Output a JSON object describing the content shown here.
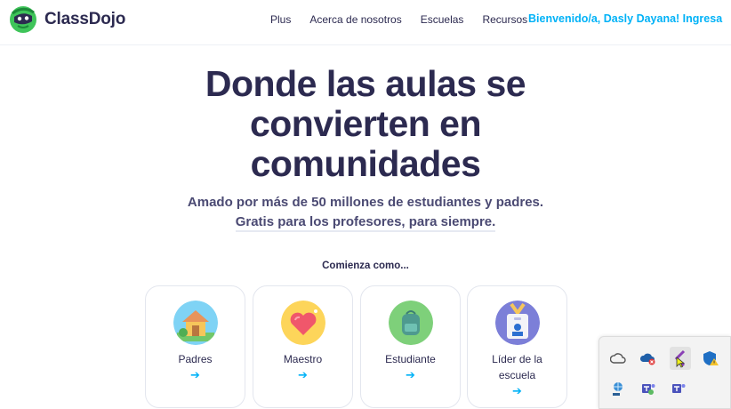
{
  "nav": {
    "brand": "ClassDojo",
    "links": [
      "Plus",
      "Acerca de nosotros",
      "Escuelas",
      "Recursos"
    ],
    "cta": "Bienvenido/a, Dasly Dayana! Ingresa"
  },
  "hero": {
    "title_lines": [
      "Donde las aulas se",
      "convierten en",
      "comunidades"
    ],
    "subtitle_line1": "Amado por más de 50 millones de estudiantes y padres.",
    "subtitle_line2": "Gratis para los profesores, para siempre."
  },
  "start_label": "Comienza como...",
  "roles": [
    {
      "label": "Padres",
      "arrow": "➔",
      "icon": "house-icon"
    },
    {
      "label": "Maestro",
      "arrow": "➔",
      "icon": "heart-icon"
    },
    {
      "label": "Estudiante",
      "arrow": "➔",
      "icon": "backpack-icon"
    },
    {
      "label": "Líder de la escuela",
      "label_line1": "Líder de la",
      "label_line2": "escuela",
      "arrow": "➔",
      "icon": "badge-icon"
    }
  ],
  "tray_icons": [
    "onedrive-icon",
    "cloud-error-icon",
    "visual-studio-icon",
    "shield-warning-icon",
    "network-globe-icon",
    "teams-icon",
    "teams-alt-icon"
  ],
  "colors": {
    "brand": "#2c2a50",
    "accent": "#00b2f7"
  }
}
